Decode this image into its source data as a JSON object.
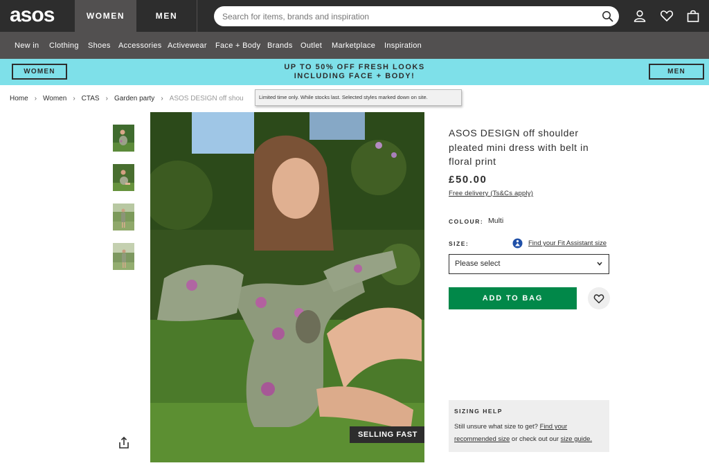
{
  "header": {
    "logo_text": "asos",
    "tabs": [
      {
        "label": "WOMEN",
        "active": true
      },
      {
        "label": "MEN",
        "active": false
      }
    ],
    "search": {
      "placeholder": "Search for items, brands and inspiration",
      "value": ""
    },
    "icons": [
      "account-icon",
      "saved-items-heart-icon",
      "bag-icon"
    ]
  },
  "nav": {
    "items": [
      "New in",
      "Clothing",
      "Shoes",
      "Accessories",
      "Activewear",
      "Face + Body",
      "Brands",
      "Outlet",
      "Marketplace",
      "Inspiration"
    ]
  },
  "promo": {
    "left_button": "WOMEN",
    "line1": "UP TO 50% OFF FRESH LOOKS",
    "line2": "INCLUDING FACE + BODY!",
    "right_button": "MEN",
    "tooltip": "Limited time only. While stocks last. Selected styles marked down on site."
  },
  "breadcrumb": [
    "Home",
    "Women",
    "CTAS",
    "Garden party",
    "ASOS DESIGN off shoulder pleated mini dress with belt in floral print"
  ],
  "gallery": {
    "thumbnail_count": 4,
    "badge": "SELLING FAST"
  },
  "product": {
    "title": "ASOS DESIGN off shoulder pleated mini dress with belt in floral print",
    "price": "£50.00",
    "delivery_link": "Free delivery (Ts&Cs apply)",
    "colour_label": "COLOUR:",
    "colour_value": "Multi",
    "size_label": "SIZE:",
    "fit_link": "Find your Fit Assistant size",
    "size_select": "Please select",
    "add_to_bag": "ADD TO BAG"
  },
  "sizing_help": {
    "title": "SIZING HELP",
    "text1": "Still unsure what size to get?",
    "link1": "Find your recommended size",
    "text2": "or check out our",
    "link2": "size guide."
  },
  "colors": {
    "header_dark": "#2d2d2d",
    "nav_grey": "#525050",
    "promo_cyan": "#7ee0e9",
    "add_to_bag_green": "#018849"
  }
}
